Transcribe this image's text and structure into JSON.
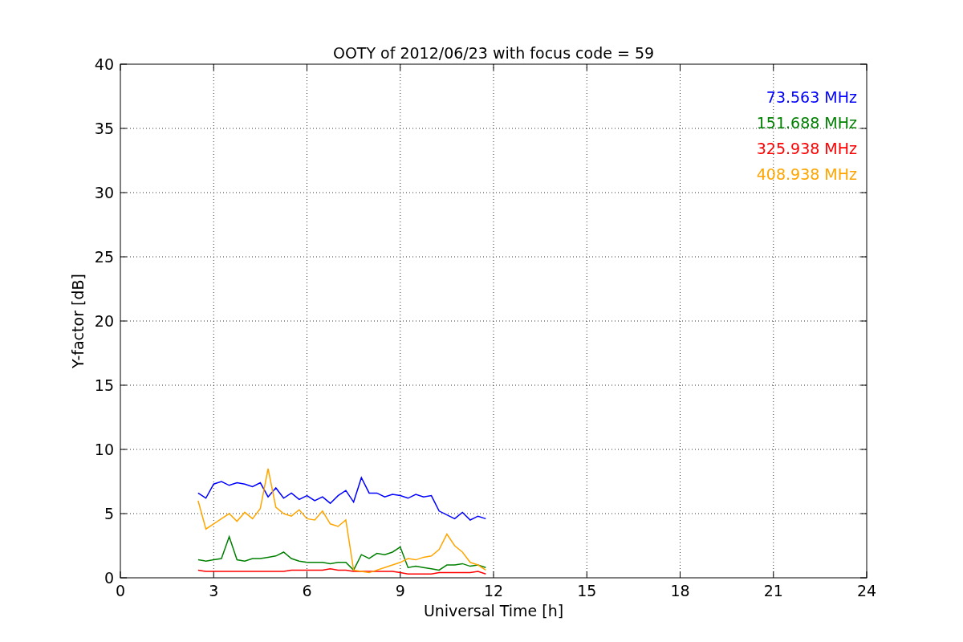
{
  "chart_data": {
    "type": "line",
    "title": "OOTY of 2012/06/23 with focus code = 59",
    "xlabel": "Universal Time [h]",
    "ylabel": "Y-factor [dB]",
    "x": [
      2.5,
      2.75,
      3,
      3.25,
      3.5,
      3.75,
      4,
      4.25,
      4.5,
      4.75,
      5,
      5.25,
      5.5,
      5.75,
      6,
      6.25,
      6.5,
      6.75,
      7,
      7.25,
      7.5,
      7.75,
      8,
      8.25,
      8.5,
      8.75,
      9,
      9.25,
      9.5,
      9.75,
      10,
      10.25,
      10.5,
      10.75,
      11,
      11.25,
      11.5,
      11.75
    ],
    "series": [
      {
        "name": "73.563 MHz",
        "color": "#0000ff",
        "values": [
          6.6,
          6.2,
          7.3,
          7.5,
          7.2,
          7.4,
          7.3,
          7.1,
          7.4,
          6.3,
          7.0,
          6.2,
          6.6,
          6.1,
          6.4,
          6.0,
          6.3,
          5.8,
          6.4,
          6.8,
          5.9,
          7.8,
          6.6,
          6.6,
          6.3,
          6.5,
          6.4,
          6.2,
          6.5,
          6.3,
          6.4,
          5.2,
          4.9,
          4.6,
          5.1,
          4.5,
          4.8,
          4.6
        ]
      },
      {
        "name": "151.688 MHz",
        "color": "#008000",
        "values": [
          1.4,
          1.3,
          1.4,
          1.5,
          3.2,
          1.4,
          1.3,
          1.5,
          1.5,
          1.6,
          1.7,
          2.0,
          1.5,
          1.3,
          1.2,
          1.2,
          1.2,
          1.1,
          1.2,
          1.2,
          0.6,
          1.8,
          1.5,
          1.9,
          1.8,
          2.0,
          2.4,
          0.8,
          0.9,
          0.8,
          0.7,
          0.6,
          1.0,
          1.0,
          1.1,
          0.9,
          1.0,
          0.8
        ]
      },
      {
        "name": "325.938 MHz",
        "color": "#ff0000",
        "values": [
          0.6,
          0.5,
          0.5,
          0.5,
          0.5,
          0.5,
          0.5,
          0.5,
          0.5,
          0.5,
          0.5,
          0.5,
          0.6,
          0.6,
          0.6,
          0.6,
          0.6,
          0.7,
          0.6,
          0.6,
          0.5,
          0.5,
          0.5,
          0.5,
          0.5,
          0.5,
          0.4,
          0.3,
          0.3,
          0.3,
          0.3,
          0.4,
          0.4,
          0.4,
          0.4,
          0.4,
          0.5,
          0.3
        ]
      },
      {
        "name": "408.938 MHz",
        "color": "#ffa500",
        "values": [
          6.0,
          3.8,
          4.2,
          4.6,
          5.0,
          4.4,
          5.1,
          4.6,
          5.4,
          8.5,
          5.5,
          5.0,
          4.8,
          5.3,
          4.6,
          4.5,
          5.2,
          4.2,
          4.0,
          4.5,
          0.6,
          0.5,
          0.4,
          0.6,
          0.8,
          1.0,
          1.2,
          1.5,
          1.4,
          1.6,
          1.7,
          2.2,
          3.4,
          2.5,
          2.0,
          1.2,
          1.0,
          0.6
        ]
      }
    ],
    "xlim": [
      0,
      24
    ],
    "ylim": [
      0,
      40
    ],
    "xticks": [
      0,
      3,
      6,
      9,
      12,
      15,
      18,
      21,
      24
    ],
    "yticks": [
      0,
      5,
      10,
      15,
      20,
      25,
      30,
      35,
      40
    ],
    "grid": true
  }
}
